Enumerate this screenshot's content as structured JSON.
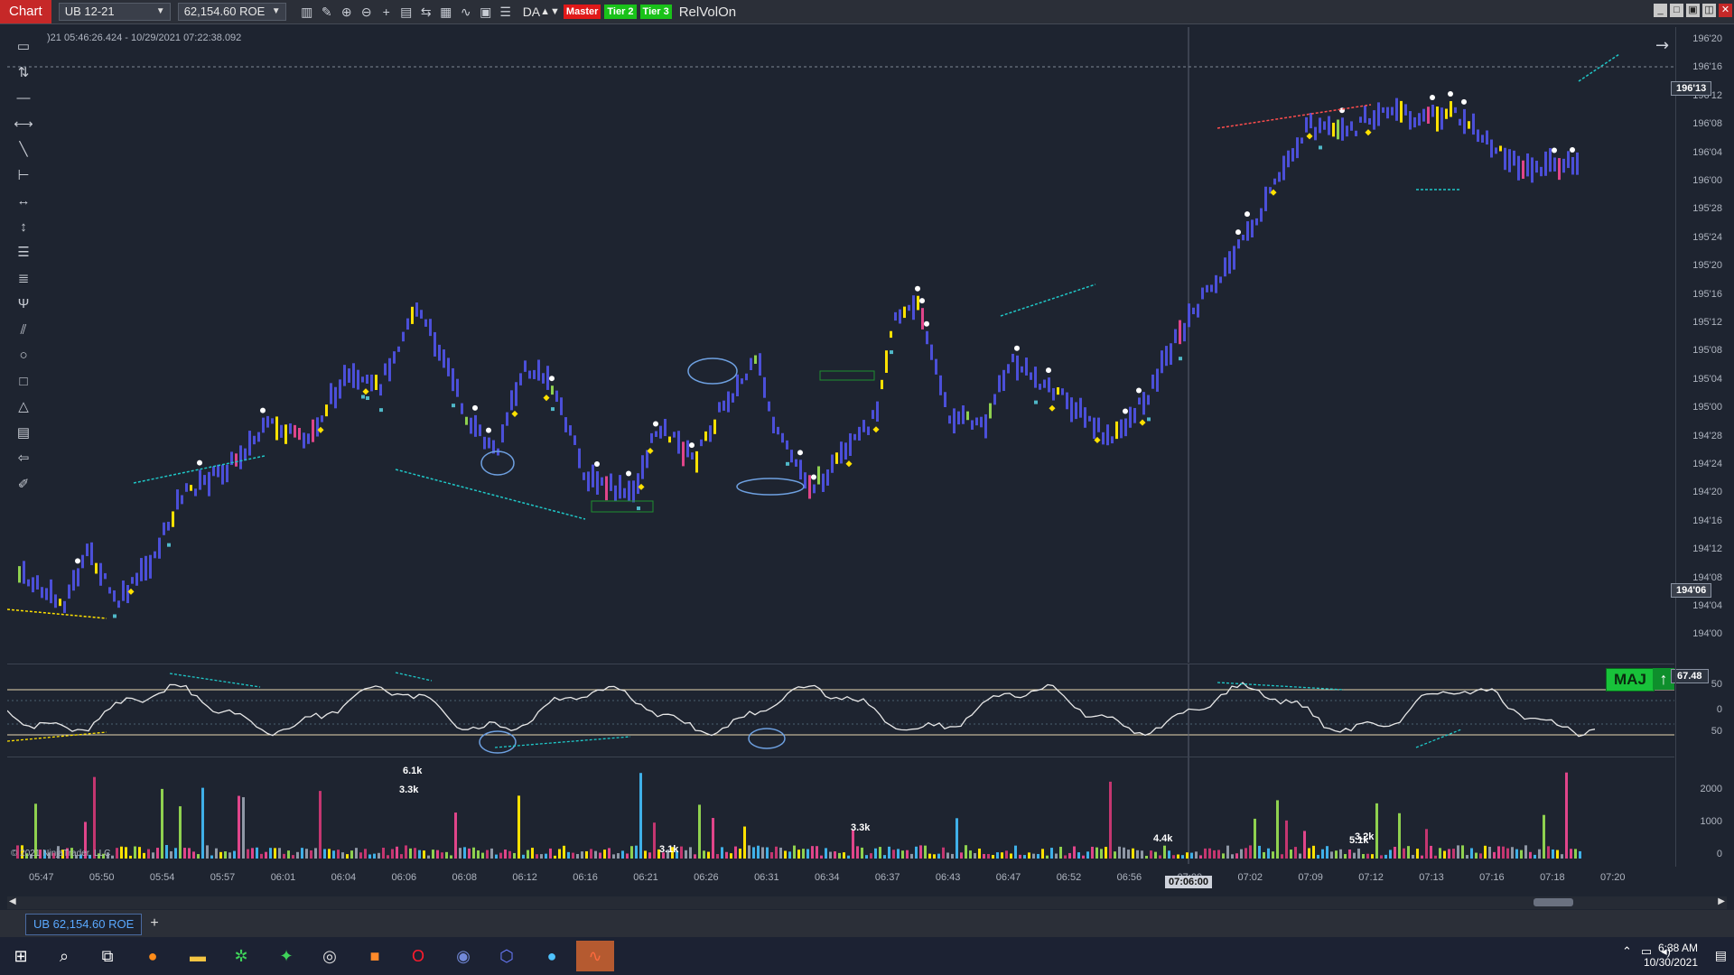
{
  "titlebar": {
    "chart_tab": "Chart",
    "instrument": "UB 12-21",
    "account": "62,154.60 ROE",
    "da_label": "DA",
    "badges": [
      "Master",
      "Tier 2",
      "Tier 3"
    ],
    "relvol": "RelVolOn",
    "icons": [
      "bar-type-icon",
      "draw-pencil-icon",
      "zoom-in-icon",
      "zoom-out-icon",
      "crosshair-icon",
      "data-box-icon",
      "chart-trader-icon",
      "indicators-icon",
      "strategies-icon",
      "properties-icon",
      "list-icon"
    ]
  },
  "left_toolbar": [
    "ruler-icon",
    "risk-reward-icon",
    "line-icon",
    "extended-line-icon",
    "ray-icon",
    "horizontal-line-icon",
    "arrow-line-icon",
    "vertical-line-icon",
    "fibonacci-icon",
    "fib-extension-icon",
    "andrews-pitchfork-icon",
    "trend-channel-icon",
    "ellipse-icon",
    "rectangle-icon",
    "triangle-icon",
    "region-icon",
    "arrow-icon",
    "text-pencil-icon"
  ],
  "info_line": ")21 05:46:26.424 - 10/29/2021 07:22:38.092",
  "price_axis": {
    "labels": [
      "196'20",
      "196'16",
      "196'12",
      "196'08",
      "196'04",
      "196'00",
      "195'28",
      "195'24",
      "195'20",
      "195'16",
      "195'12",
      "195'08",
      "195'04",
      "195'00",
      "194'28",
      "194'24",
      "194'20",
      "194'16",
      "194'12",
      "194'08",
      "194'04",
      "194'00"
    ],
    "current_price": "196'13",
    "marker_price": "194'06"
  },
  "oscillator": {
    "badge_text": "MAJ",
    "badge_arrow": "↑",
    "value": "67.48",
    "axis_labels": [
      "50",
      "0",
      "50"
    ]
  },
  "volume": {
    "axis_labels": [
      "2000",
      "1000",
      "0"
    ],
    "bar_labels": [
      "6.1k",
      "3.3k",
      "3.1k",
      "3.3k",
      "4.4k",
      "5.1k",
      "3.2k"
    ],
    "copyright": "© 2021 NinjaTrader, LLC"
  },
  "time_axis": {
    "labels": [
      "05:47",
      "05:50",
      "05:54",
      "05:57",
      "06:01",
      "06:04",
      "06:06",
      "06:08",
      "06:12",
      "06:16",
      "06:21",
      "06:26",
      "06:31",
      "06:34",
      "06:37",
      "06:43",
      "06:47",
      "06:52",
      "06:56",
      "07:00",
      "07:02",
      "07:09",
      "07:12",
      "07:13",
      "07:16",
      "07:18",
      "07:20"
    ],
    "cursor_time": "07:06:00"
  },
  "bottom_tab": "UB 62,154.60 ROE",
  "taskbar": {
    "apps": [
      "windows-start-icon",
      "search-icon",
      "task-view-icon",
      "firefox-icon",
      "file-explorer-icon",
      "app-green-icon",
      "app-turtle-icon",
      "obs-icon",
      "app-orange-icon",
      "opera-icon",
      "discord-icon",
      "app-blue-hex-icon",
      "app-blue-circle-icon",
      "ninjatrader-icon"
    ],
    "time": "6:38 AM",
    "date": "10/30/2021"
  },
  "colors": {
    "background": "#1e2430",
    "bar_blue": "#4b4fd8",
    "signal_yellow": "#ffe100",
    "vol_pink": "#e0458a",
    "vol_gray": "#8f98a6",
    "trend_cyan": "#1fc8c8",
    "trend_red": "#ff4d4d",
    "maj_green": "#18c23a"
  }
}
